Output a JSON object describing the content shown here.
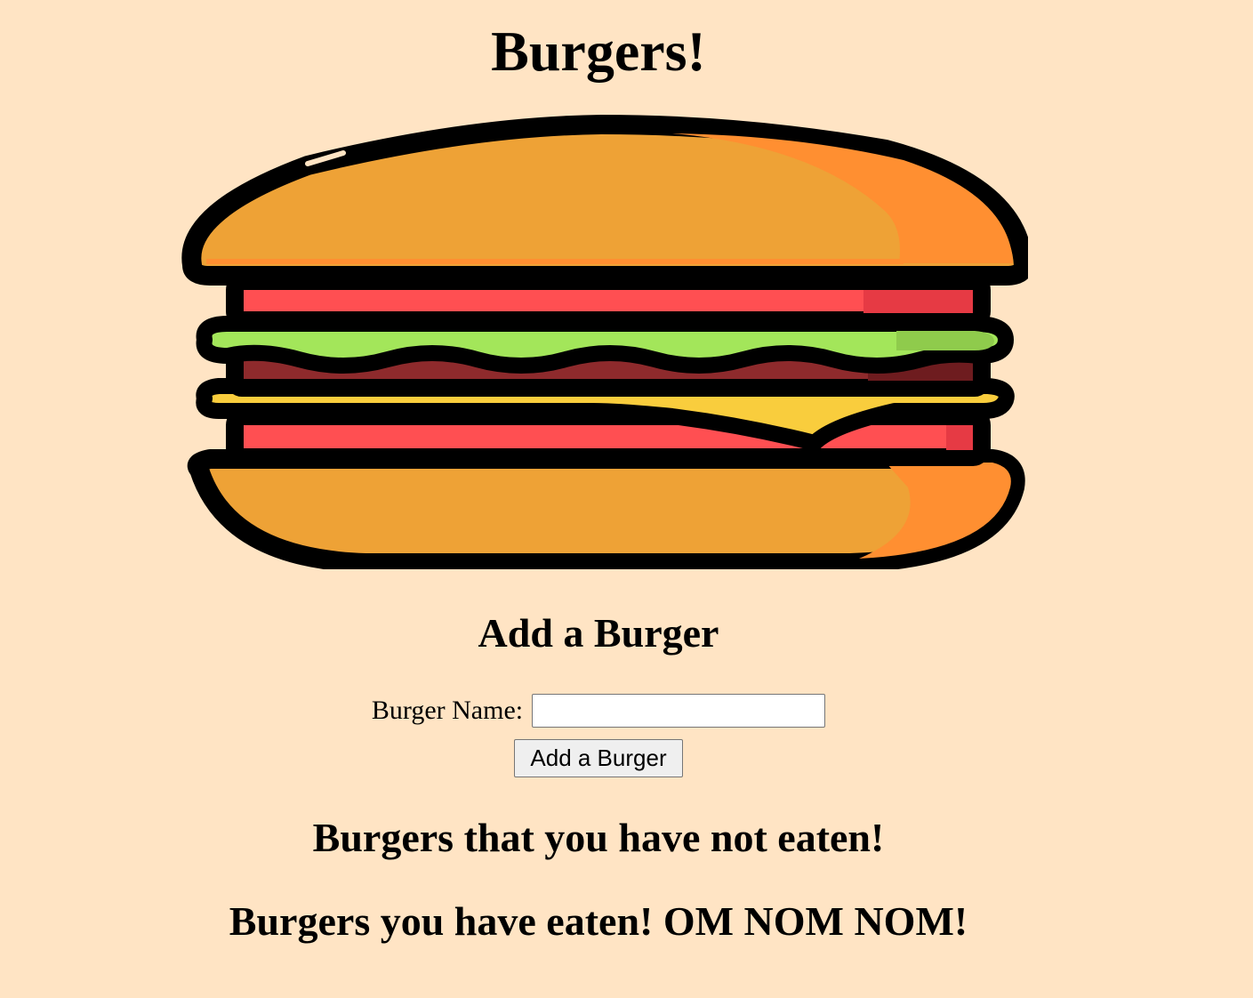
{
  "page": {
    "title": "Burgers!"
  },
  "hero": {
    "icon": "hamburger-icon",
    "colors": {
      "bun": "#EEA236",
      "bun_shadow": "#FF8F31",
      "tomato": "#FF4F52",
      "lettuce": "#A3E65A",
      "patty": "#8E2A2C",
      "cheese": "#F9CD3D",
      "outline": "#000000"
    }
  },
  "add_form": {
    "heading": "Add a Burger",
    "label": "Burger Name:",
    "input_value": "",
    "button_label": "Add a Burger"
  },
  "lists": {
    "not_eaten_heading": "Burgers that you have not eaten!",
    "eaten_heading": "Burgers you have eaten! OM NOM NOM!"
  },
  "colors": {
    "background": "#FFE4C4"
  }
}
